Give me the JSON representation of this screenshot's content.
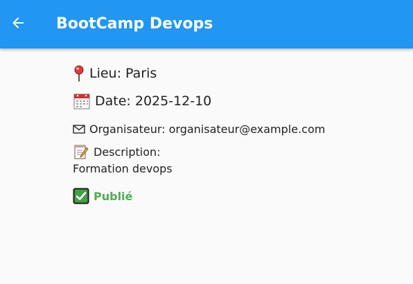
{
  "appbar": {
    "title": "BootCamp Devops",
    "back_icon": "arrow-back-icon",
    "color": "#2196f3"
  },
  "event": {
    "lieu": "Lieu: Paris",
    "date": "Date: 2025-12-10",
    "organisateur": "Organisateur: organisateur@example.com",
    "description_label": "Description:",
    "description": "Formation devops",
    "status": "Publié",
    "status_color": "#4caf50"
  },
  "icons": {
    "lieu": "pin-icon",
    "date": "calendar-icon",
    "organisateur": "envelope-icon",
    "description": "memo-icon",
    "status": "check-box-icon"
  }
}
